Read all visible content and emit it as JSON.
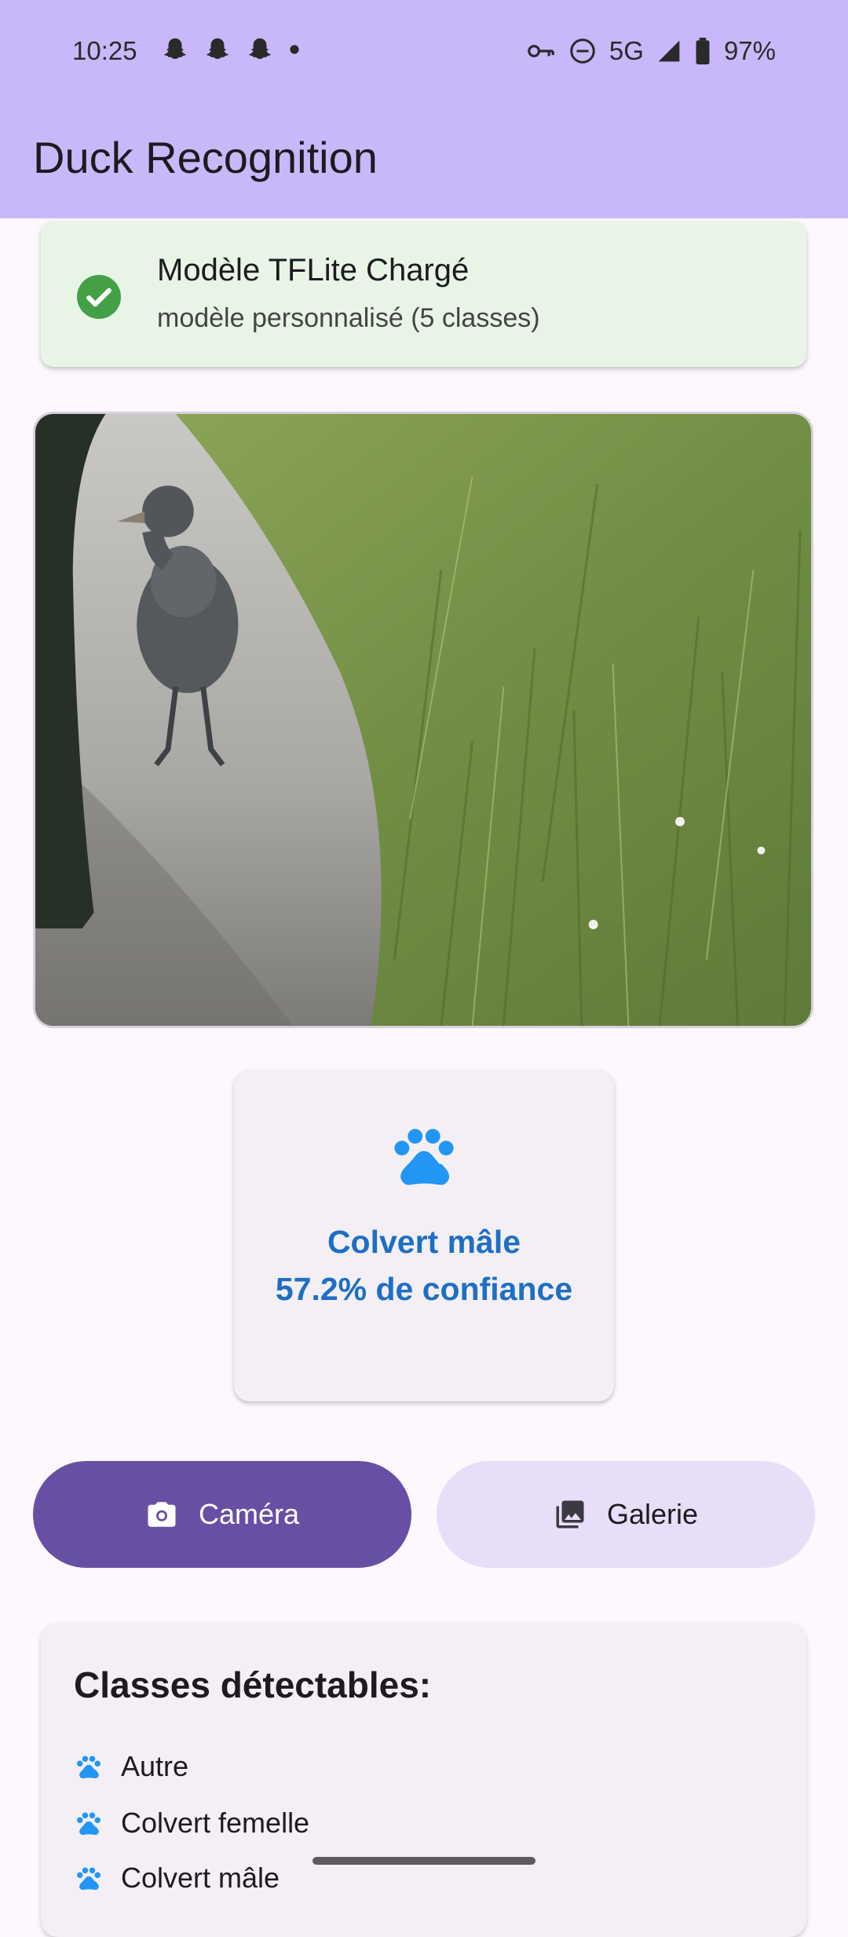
{
  "status_bar": {
    "time": "10:25",
    "network": "5G",
    "battery": "97%"
  },
  "app": {
    "title": "Duck Recognition",
    "appbar_color": "#C9B8F9"
  },
  "model_status": {
    "title": "Modèle TFLite Chargé",
    "subtitle": "modèle personnalisé (5 classes)",
    "icon": "check-circle-icon",
    "color": "#43A047"
  },
  "result": {
    "icon": "paw-icon",
    "label": "Colvert mâle",
    "confidence_text": "57.2% de confiance",
    "color": "#1E6FC4"
  },
  "actions": {
    "camera_label": "Caméra",
    "gallery_label": "Galerie"
  },
  "classes": {
    "title": "Classes détectables:",
    "items": [
      {
        "label": "Autre"
      },
      {
        "label": "Colvert femelle"
      },
      {
        "label": "Colvert mâle"
      }
    ]
  }
}
